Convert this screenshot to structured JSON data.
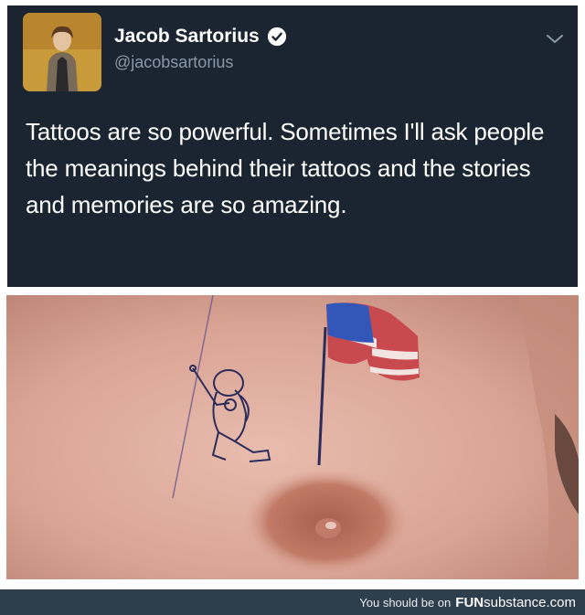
{
  "tweet": {
    "author_name": "Jacob Sartorius",
    "handle": "@jacobsartorius",
    "text": "Tattoos are so powerful. Sometimes I'll ask people the meanings behind their tattoos and the stories and memories are so amazing.",
    "verified": true,
    "icons": {
      "verified": "verified-badge-icon",
      "menu": "chevron-down-icon"
    }
  },
  "photo": {
    "icons": {
      "astronaut": "astronaut-tattoo",
      "flag": "american-flag-tattoo"
    }
  },
  "footer": {
    "prefix": "You should be on",
    "brand_fun": "FUN",
    "brand_substance": "substance.com"
  },
  "colors": {
    "tweet_bg": "#1b2531",
    "footer_bg": "#2f3e4d",
    "handle": "#8899a6",
    "verified": "#ffffff"
  }
}
